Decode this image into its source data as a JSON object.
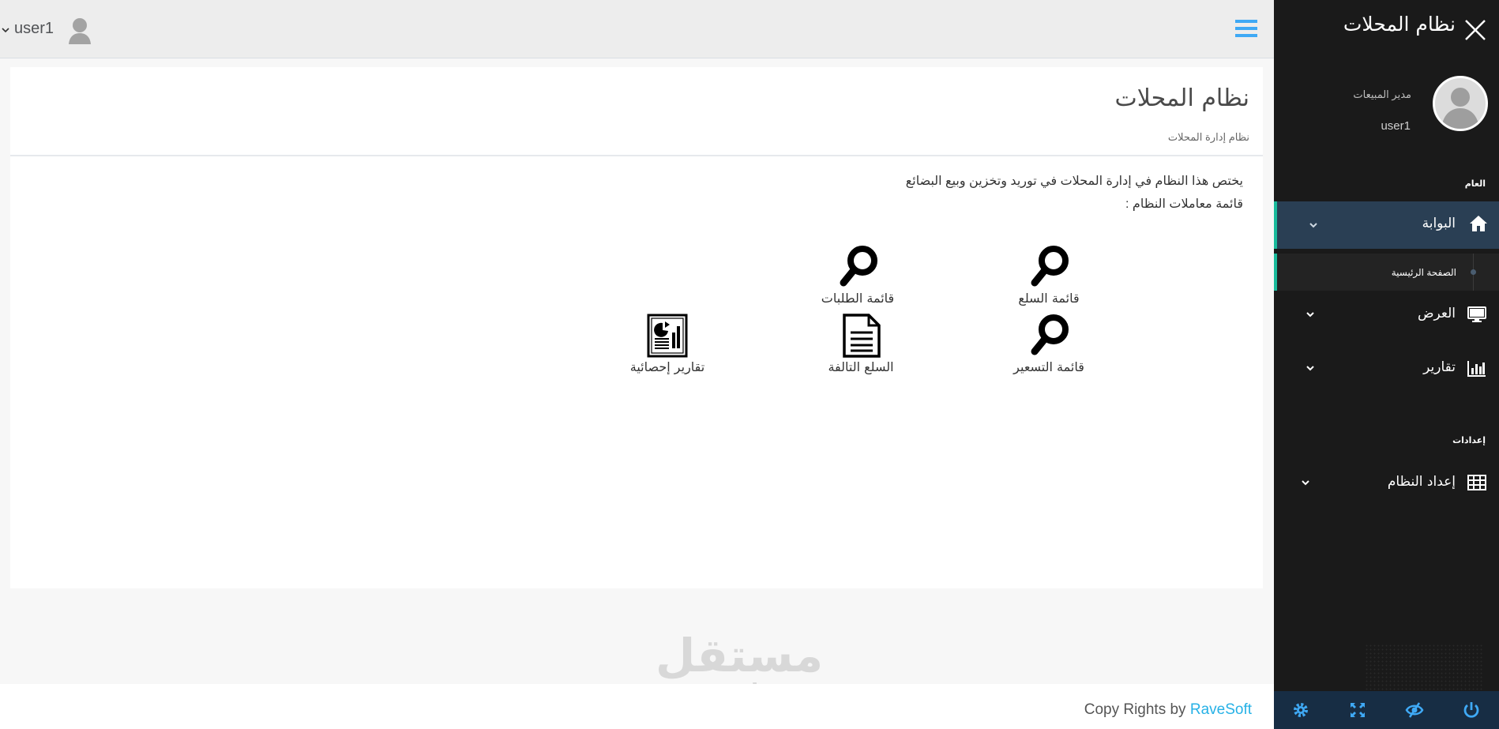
{
  "sidebar": {
    "brand": "نظام المحلات",
    "profile": {
      "role": "مدير المبيعات",
      "username": "user1"
    },
    "sections": {
      "general": "العام",
      "settings": "إعدادات"
    },
    "menu": {
      "portal": "البوابة",
      "home": "الصفحة الرئيسية",
      "display": "العرض",
      "reports": "تقارير",
      "system_setup": "إعداد النظام"
    },
    "footer_icons": [
      "gear-icon",
      "fullscreen-icon",
      "eye-slash-icon",
      "power-icon"
    ]
  },
  "topbar": {
    "username": "user1"
  },
  "panel": {
    "title": "نظام المحلات",
    "subtitle": "نظام إدارة المحلات",
    "description": "يختص هذا النظام في إدارة المحلات في توريد وتخزين وبيع البضائع",
    "list_heading": "قائمة معاملات النظام :",
    "tiles": {
      "goods_list": "قائمة السلع",
      "orders_list": "قائمة الطلبات",
      "pricing_list": "قائمة التسعير",
      "damaged_goods": "السلع التالفة",
      "statistical_reports": "تقارير إحصائية"
    }
  },
  "footer": {
    "copy_text": "Copy Rights by ",
    "brand": "RaveSoft"
  },
  "watermark": {
    "arabic": "مستقل",
    "latin": "mostaql.com"
  },
  "colors": {
    "sidebar_bg": "#1a1a1a",
    "active_bg": "#2a3f54",
    "accent": "#1abb9c",
    "link": "#26b1e6",
    "icon_blue": "#3fa9f5"
  }
}
